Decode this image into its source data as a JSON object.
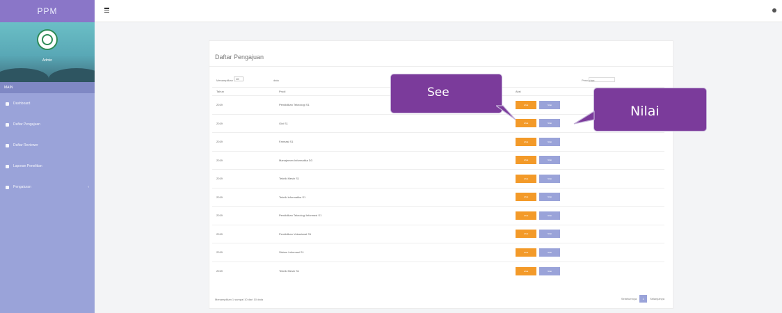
{
  "sidebar": {
    "brand": "PPM",
    "user_name": "Admin",
    "section_label": "MAIN",
    "items": [
      {
        "label": "Dashboard",
        "icon": "home-icon"
      },
      {
        "label": "Daftar Pengajuan",
        "icon": "list-icon"
      },
      {
        "label": "Daftar Reviewer",
        "icon": "users-icon"
      },
      {
        "label": "Laporan Penelitian",
        "icon": "file-icon"
      },
      {
        "label": "Pengaturan",
        "icon": "gear-icon",
        "chevron": "‹"
      }
    ]
  },
  "card": {
    "title": "Daftar Pengajuan",
    "show_label": "Menampilkan",
    "entries_value": "10",
    "entries_suffix": "data",
    "search_label": "Pencarian:",
    "columns": [
      "Tahun",
      "Prodi",
      "Aksi"
    ],
    "rows": [
      {
        "year": "2019",
        "prodi": "Pendidikan Teknologi S1"
      },
      {
        "year": "2019",
        "prodi": "Gizi S1"
      },
      {
        "year": "2019",
        "prodi": "Farmasi S1"
      },
      {
        "year": "2019",
        "prodi": "Manajemen Informatika D3"
      },
      {
        "year": "2019",
        "prodi": "Teknik Mesin S1"
      },
      {
        "year": "2019",
        "prodi": "Teknik Informatika S1"
      },
      {
        "year": "2019",
        "prodi": "Pendidikan Teknologi Informasi S1"
      },
      {
        "year": "2019",
        "prodi": "Pendidikan Vokasional S1"
      },
      {
        "year": "2019",
        "prodi": "Sistem Informasi S1"
      },
      {
        "year": "2019",
        "prodi": "Teknik Mesin S1"
      }
    ],
    "see_label": "Lihat",
    "nilai_label": "Nilai",
    "footer": "Menampilkan 1 sampai 10 dari 10 data",
    "prev_label": "Sebelumnya",
    "current_page": "1",
    "next_label": "Selanjutnya"
  },
  "callouts": {
    "see": "See",
    "nilai": "Nilai"
  },
  "colors": {
    "sidebar": "#9aa3d9",
    "brand": "#8a76c8",
    "see_button": "#f39a29",
    "nilai_button": "#9aa3d9",
    "callout": "#7b3b9b"
  }
}
